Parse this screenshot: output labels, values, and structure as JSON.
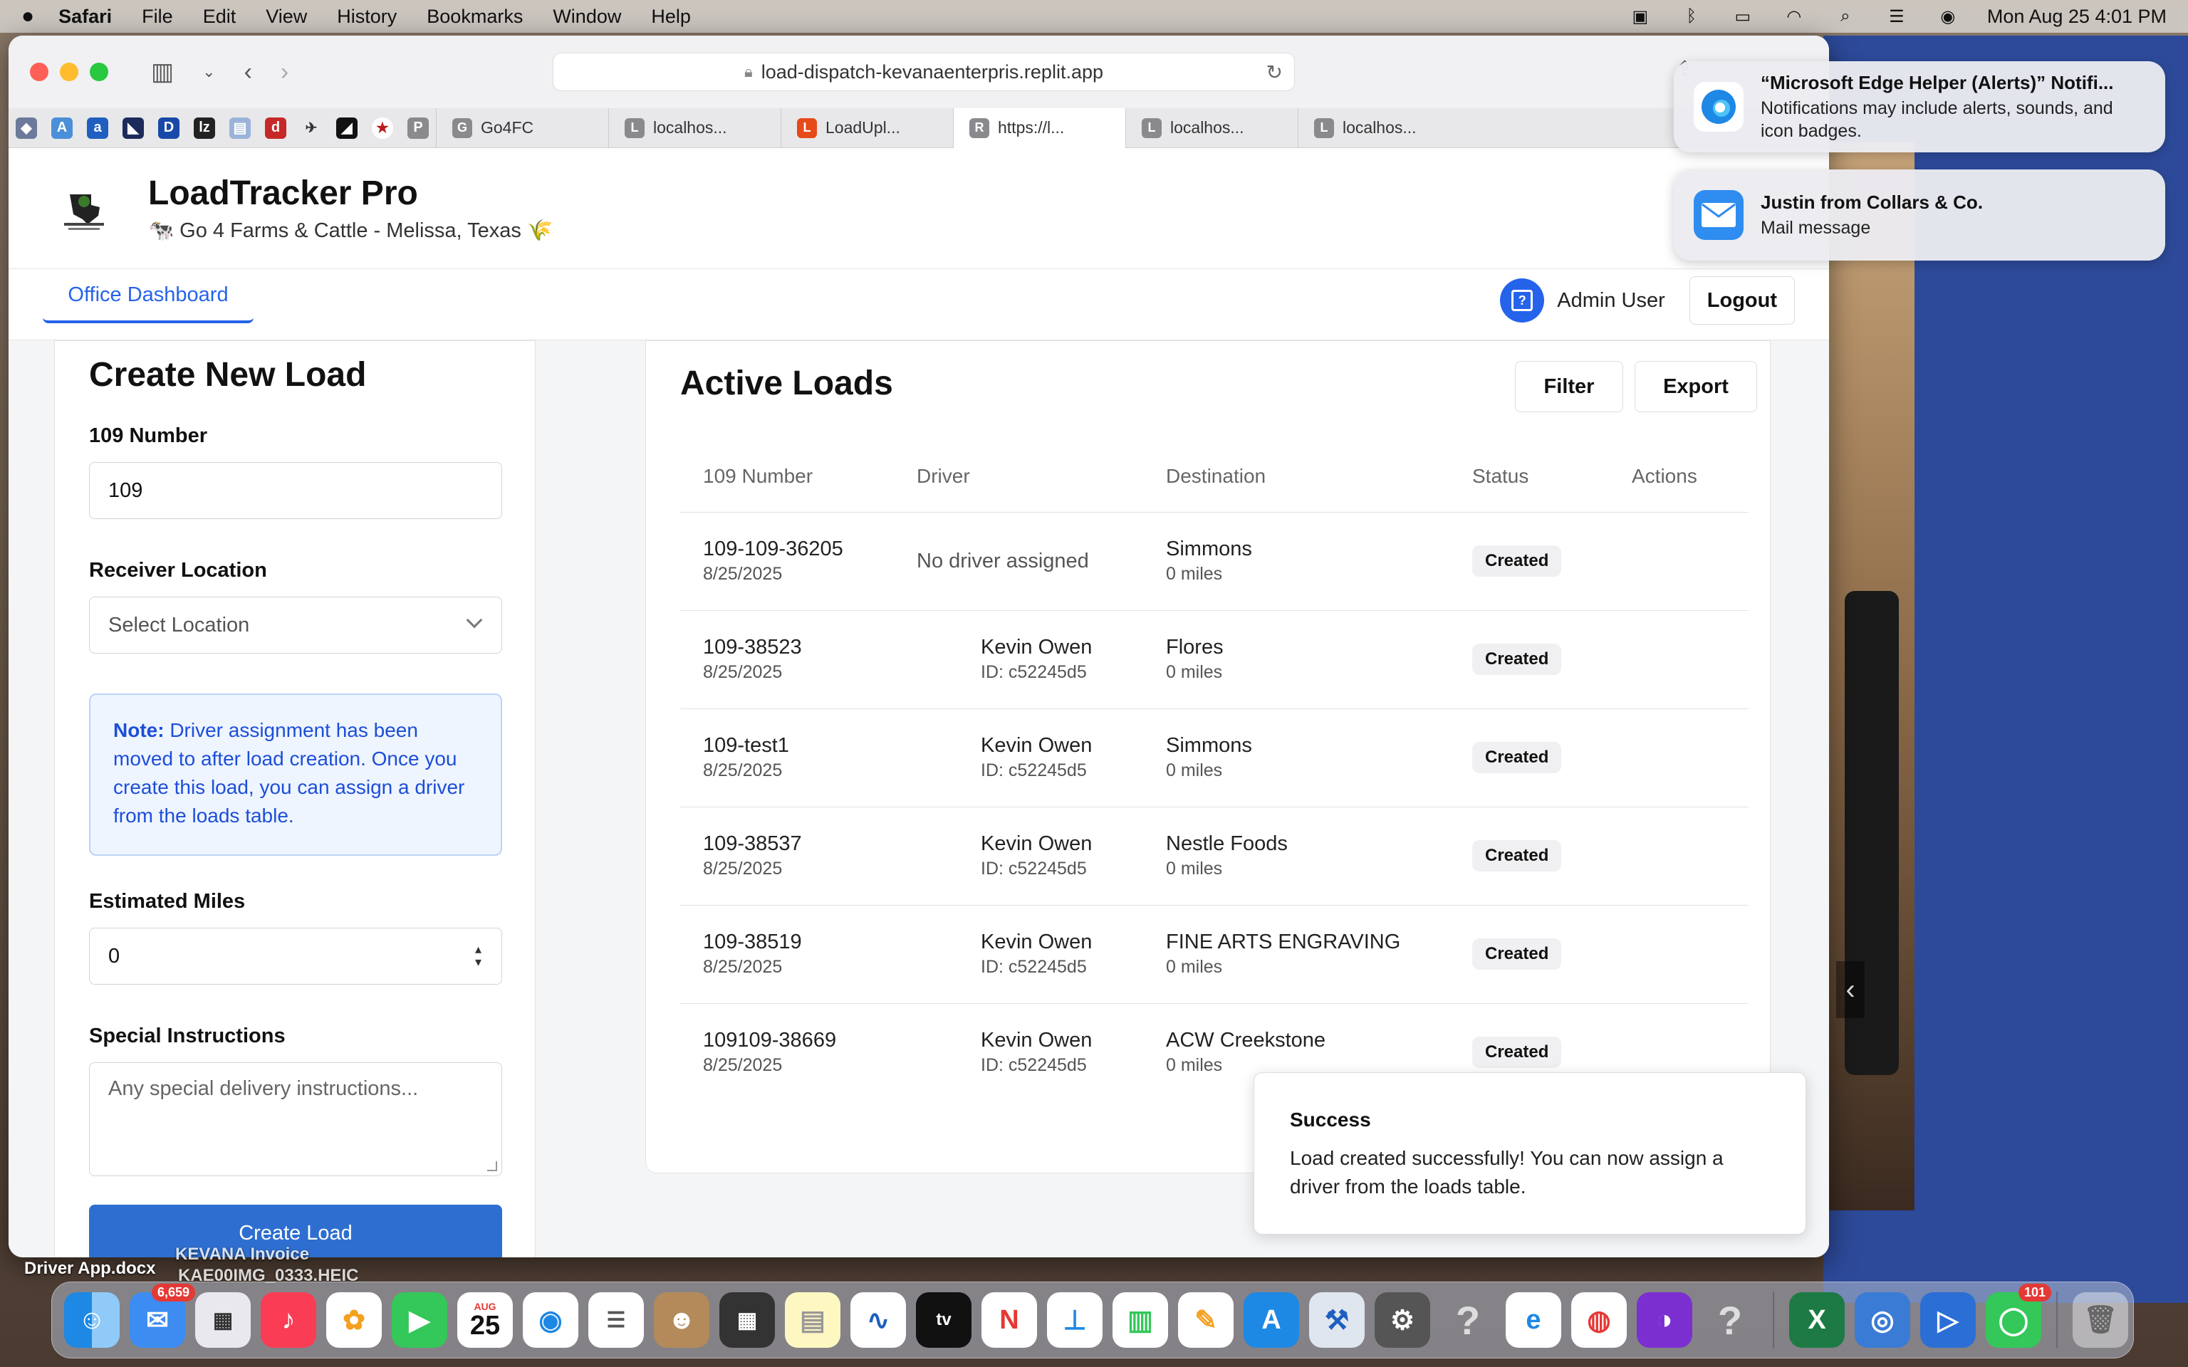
{
  "menubar": {
    "app": "Safari",
    "items": [
      "File",
      "Edit",
      "View",
      "History",
      "Bookmarks",
      "Window",
      "Help"
    ],
    "clock": "Mon Aug 25  4:01 PM"
  },
  "browser": {
    "url": "load-dispatch-kevanaenterpris.replit.app",
    "tabs": [
      {
        "icon": "G",
        "label": "Go4FC"
      },
      {
        "icon": "L",
        "label": "localhos..."
      },
      {
        "icon": "L",
        "label": "LoadUpl..."
      },
      {
        "icon": "R",
        "label": "https://l..."
      },
      {
        "icon": "L",
        "label": "localhos..."
      },
      {
        "icon": "L",
        "label": "localhos..."
      }
    ]
  },
  "header": {
    "title": "LoadTracker Pro",
    "subtitle": "🐄 Go 4 Farms & Cattle - Melissa, Texas 🌾"
  },
  "nav": {
    "active_tab": "Office Dashboard",
    "user_name": "Admin User",
    "logout": "Logout"
  },
  "create_form": {
    "title": "Create New Load",
    "number_label": "109 Number",
    "number_value": "109",
    "receiver_label": "Receiver Location",
    "receiver_placeholder": "Select Location",
    "note_bold": "Note:",
    "note_text": " Driver assignment has been moved to after load creation. Once you create this load, you can assign a driver from the loads table.",
    "miles_label": "Estimated Miles",
    "miles_value": "0",
    "instructions_label": "Special Instructions",
    "instructions_placeholder": "Any special delivery instructions...",
    "submit": "Create Load"
  },
  "loads": {
    "title": "Active Loads",
    "filter": "Filter",
    "export": "Export",
    "columns": [
      "109 Number",
      "Driver",
      "Destination",
      "Status",
      "Actions"
    ],
    "rows": [
      {
        "number": "109-109-36205",
        "date": "8/25/2025",
        "driver": "No driver assigned",
        "driver_id": "",
        "destination": "Simmons",
        "miles": "0 miles",
        "status": "Created"
      },
      {
        "number": "109-38523",
        "date": "8/25/2025",
        "driver": "Kevin Owen",
        "driver_id": "ID: c52245d5",
        "destination": "Flores",
        "miles": "0 miles",
        "status": "Created"
      },
      {
        "number": "109-test1",
        "date": "8/25/2025",
        "driver": "Kevin Owen",
        "driver_id": "ID: c52245d5",
        "destination": "Simmons",
        "miles": "0 miles",
        "status": "Created"
      },
      {
        "number": "109-38537",
        "date": "8/25/2025",
        "driver": "Kevin Owen",
        "driver_id": "ID: c52245d5",
        "destination": "Nestle Foods",
        "miles": "0 miles",
        "status": "Created"
      },
      {
        "number": "109-38519",
        "date": "8/25/2025",
        "driver": "Kevin Owen",
        "driver_id": "ID: c52245d5",
        "destination": "FINE ARTS ENGRAVING",
        "miles": "0 miles",
        "status": "Created"
      },
      {
        "number": "109109-38669",
        "date": "8/25/2025",
        "driver": "Kevin Owen",
        "driver_id": "ID: c52245d5",
        "destination": "ACW Creekstone",
        "miles": "0 miles",
        "status": "Created"
      }
    ]
  },
  "toast": {
    "title": "Success",
    "message": "Load created successfully! You can now assign a driver from the loads table."
  },
  "notifications": [
    {
      "title": "“Microsoft Edge Helper (Alerts)” Notifi...",
      "body": "Notifications may include alerts, sounds, and icon badges."
    },
    {
      "title": "Justin from Collars & Co.",
      "body": "Mail message"
    }
  ],
  "desktop_files": [
    "Driver App.docx",
    "KEVANA Invoice",
    "KAE00IMG_0333.HEIC"
  ],
  "dock": {
    "mail_badge": "6,659",
    "messages_badge": "101",
    "calendar_month": "AUG",
    "calendar_day": "25"
  },
  "colors": {
    "accent": "#2563eb",
    "button": "#2e6ed0",
    "note_bg": "#eef5ff"
  }
}
